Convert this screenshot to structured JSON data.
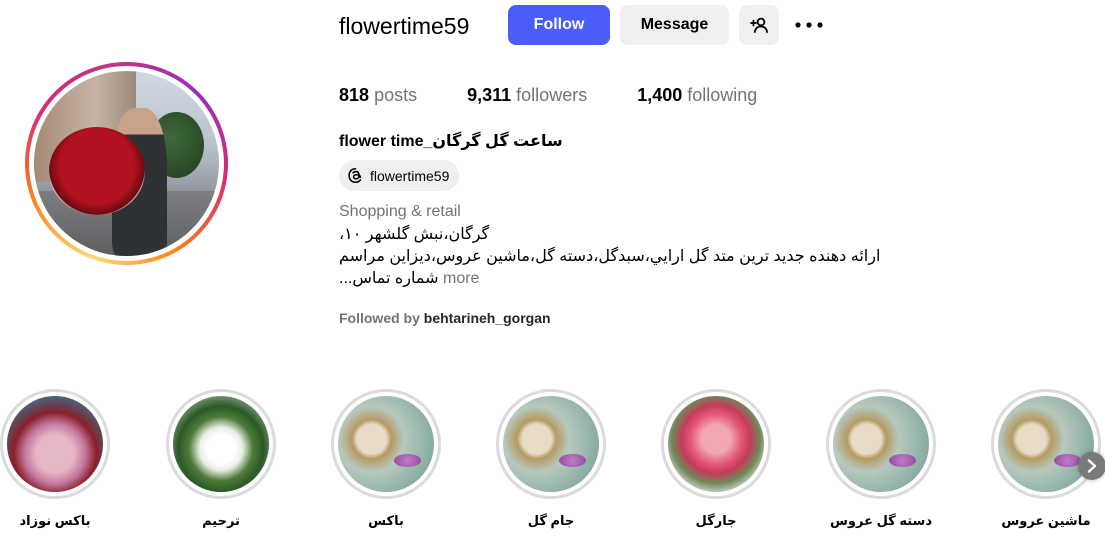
{
  "profile": {
    "username": "flowertime59",
    "full_name": "ساعت گل گرگان_flower time",
    "threads_handle": "flowertime59",
    "category": "Shopping & retail",
    "bio_lines": [
      "گرگان،نبش گلشهر ۱۰،",
      "ارائه دهنده جدید ترین متد گل ارايي،سبدگل،دسته گل،ماشین عروس،دیزاین مراسم",
      "شماره تماس..."
    ],
    "more_label": "more",
    "followed_by_prefix": "Followed by",
    "followed_by_name": "behtarineh_gorgan"
  },
  "actions": {
    "follow_label": "Follow",
    "message_label": "Message",
    "add_user_icon": "person-plus-icon",
    "more_icon": "more-horizontal-icon"
  },
  "stats": {
    "posts_count": "818",
    "posts_label": "posts",
    "followers_count": "9,311",
    "followers_label": "followers",
    "following_count": "1,400",
    "following_label": "following"
  },
  "highlights": [
    {
      "label": "باکس نوزاد"
    },
    {
      "label": "ترحیم"
    },
    {
      "label": "باکس"
    },
    {
      "label": "جام گل"
    },
    {
      "label": "جارگل"
    },
    {
      "label": "دسته گل عروس"
    },
    {
      "label": "ماشین عروس"
    }
  ],
  "colors": {
    "follow_button": "#4a5df9",
    "secondary_button": "#efefef",
    "muted_text": "#737373"
  }
}
